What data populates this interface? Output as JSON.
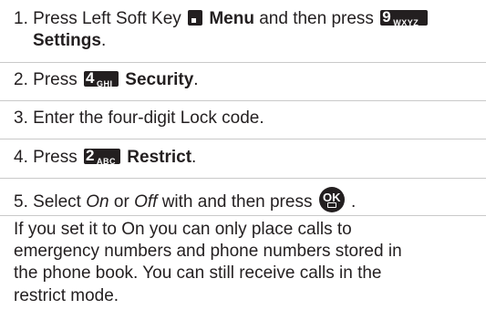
{
  "steps": [
    {
      "number": "1.",
      "before": "Press Left Soft Key",
      "key_label": "Menu",
      "middle": "and then press",
      "key2": {
        "num": "9",
        "sub": "WXYZ"
      },
      "cont_label": "Settings",
      "cont_after": "."
    },
    {
      "number": "2.",
      "before": "Press",
      "key": {
        "num": "4",
        "sub": "GHI"
      },
      "label": "Security",
      "after": "."
    },
    {
      "number": "3.",
      "text": "Enter the four-digit Lock code."
    },
    {
      "number": "4.",
      "before": "Press",
      "key": {
        "num": "2",
        "sub": "ABC"
      },
      "label": "Restrict",
      "after": "."
    },
    {
      "number": "5.",
      "before": "Select",
      "opt1": "On",
      "or": "or",
      "opt2": "Off",
      "middle": "with and then press",
      "ok_key": "OK",
      "after": "."
    }
  ],
  "note_lines": [
    "If you set it to On you can only place calls to",
    "emergency numbers and phone numbers stored in",
    "the phone book. You can still receive calls in the",
    "restrict mode."
  ],
  "icons": {
    "soft_key": "left-soft-key-icon",
    "ok": "ok-camera-key-icon"
  }
}
